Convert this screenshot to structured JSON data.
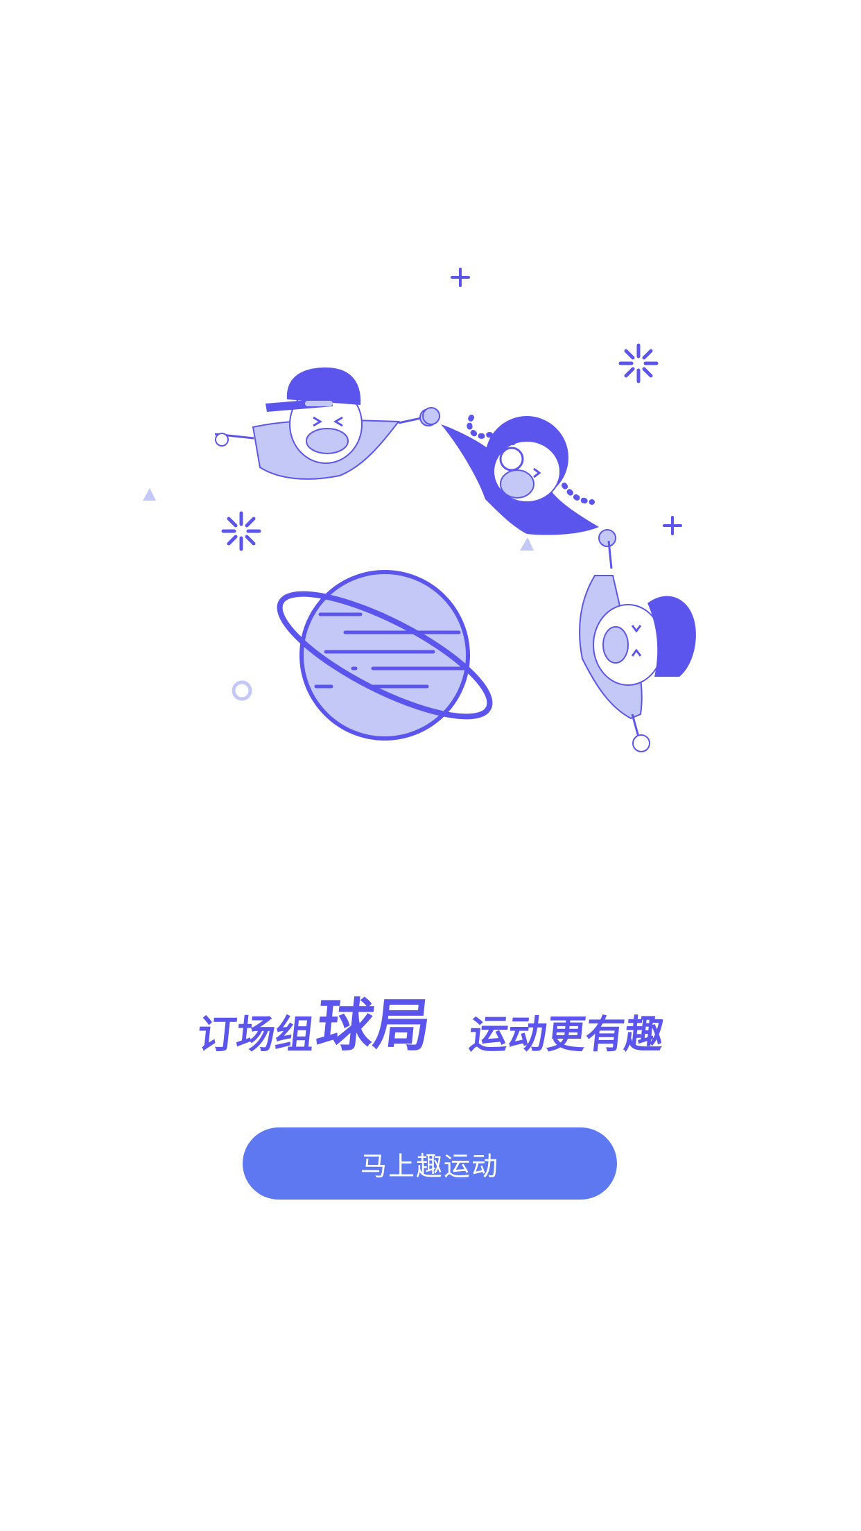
{
  "tagline": {
    "small_part": "订场组",
    "big_part": "球局",
    "second_part": "运动更有趣"
  },
  "cta": {
    "label": "马上趣运动"
  },
  "colors": {
    "primary": "#5B55EE",
    "light": "#C3C8F6",
    "button": "#5E78F2",
    "background": "#FFFFFF"
  },
  "illustration": {
    "icons": [
      "boy-with-cap-icon",
      "girl-with-pigtails-icon",
      "boy-with-curly-hair-icon",
      "planet-icon",
      "sparkle-icon",
      "plus-icon",
      "triangle-icon",
      "ring-icon"
    ]
  }
}
